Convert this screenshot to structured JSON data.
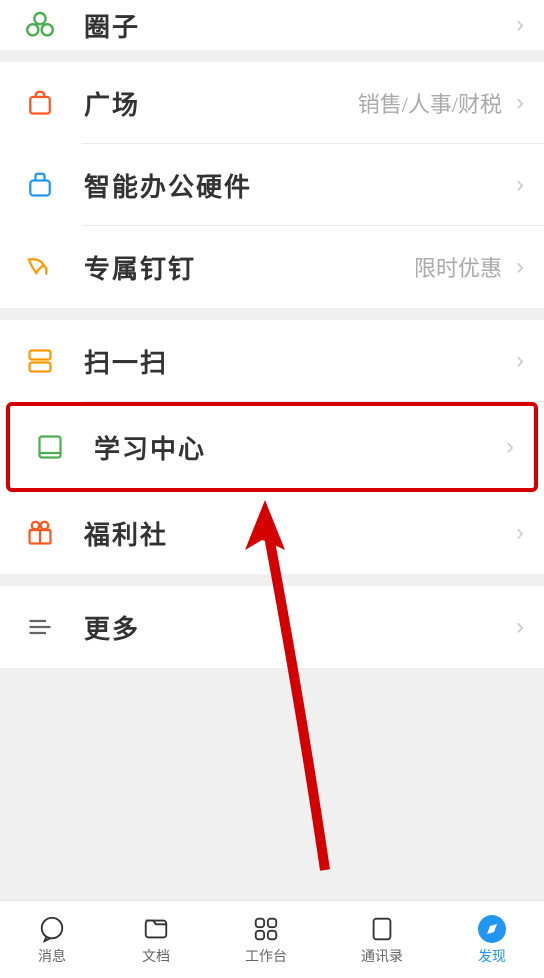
{
  "section1": {
    "items": [
      {
        "label": "圈子",
        "subtitle": "",
        "iconName": "circles-icon",
        "iconColor": "#4caf50"
      }
    ]
  },
  "section2": {
    "items": [
      {
        "label": "广场",
        "subtitle": "销售/人事/财税",
        "iconName": "bag-icon",
        "iconColor": "#ff5722"
      },
      {
        "label": "智能办公硬件",
        "subtitle": "",
        "iconName": "device-icon",
        "iconColor": "#2196f3"
      },
      {
        "label": "专属钉钉",
        "subtitle": "限时优惠",
        "iconName": "wing-icon",
        "iconColor": "#ff9800"
      }
    ]
  },
  "section3": {
    "items": [
      {
        "label": "扫一扫",
        "subtitle": "",
        "iconName": "scan-icon",
        "iconColor": "#ff9800"
      },
      {
        "label": "学习中心",
        "subtitle": "",
        "iconName": "book-icon",
        "iconColor": "#4caf50",
        "highlight": true
      },
      {
        "label": "福利社",
        "subtitle": "",
        "iconName": "gift-icon",
        "iconColor": "#ff5722"
      }
    ]
  },
  "section4": {
    "items": [
      {
        "label": "更多",
        "subtitle": "",
        "iconName": "more-icon",
        "iconColor": "#666"
      }
    ]
  },
  "nav": [
    {
      "label": "消息",
      "iconName": "message-icon"
    },
    {
      "label": "文档",
      "iconName": "doc-icon"
    },
    {
      "label": "工作台",
      "iconName": "grid-icon"
    },
    {
      "label": "通讯录",
      "iconName": "contacts-icon"
    },
    {
      "label": "发现",
      "iconName": "discover-icon",
      "active": true
    }
  ]
}
